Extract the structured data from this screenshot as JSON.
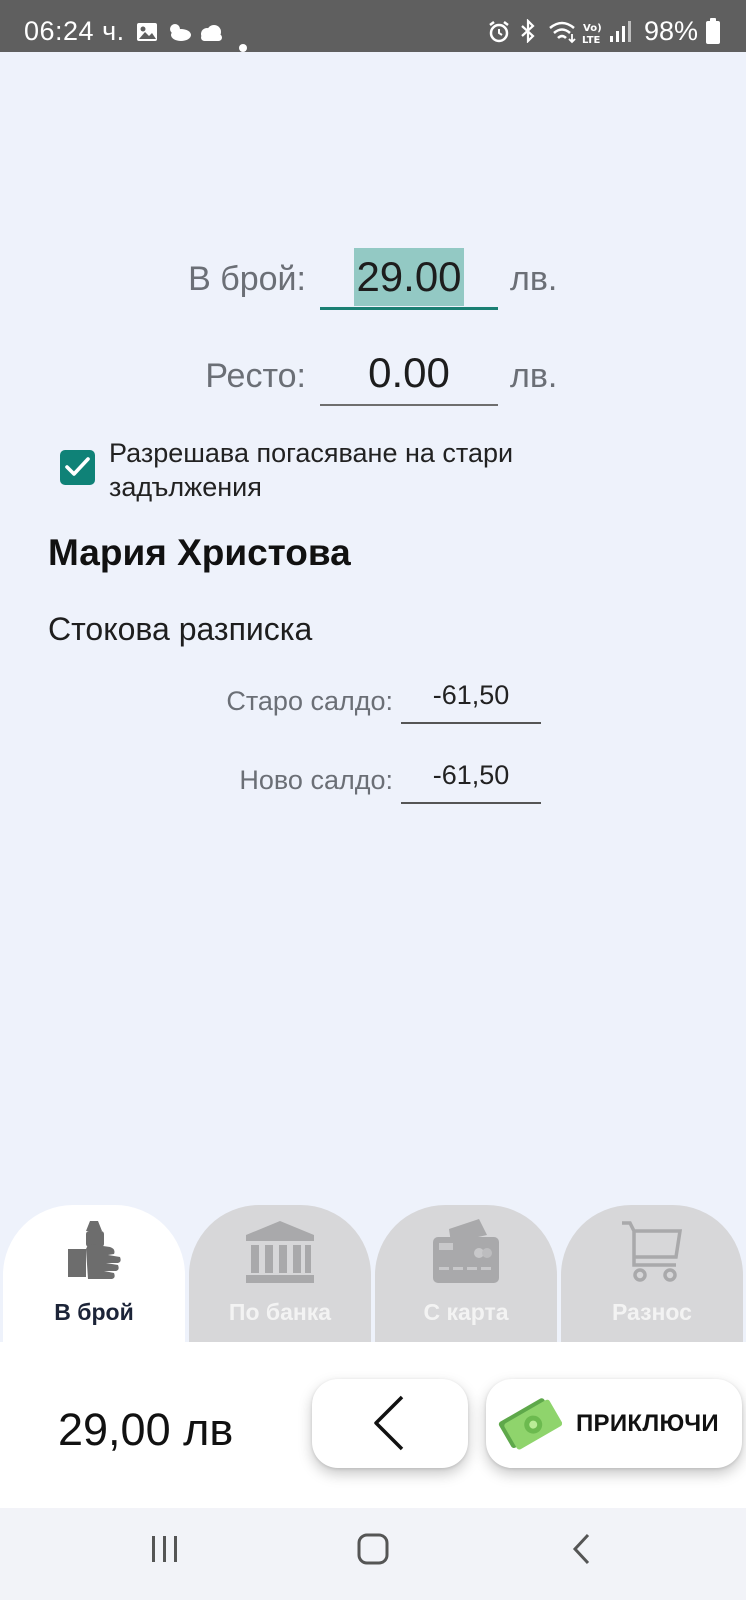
{
  "status_bar": {
    "time": "06:24 ч.",
    "battery": "98%",
    "icons": [
      "gallery-icon",
      "partly-sunny-icon",
      "cloud-icon",
      "dot-icon",
      "alarm-icon",
      "bluetooth-icon",
      "wifi-icon",
      "volte-icon",
      "signal-icon",
      "battery-icon"
    ]
  },
  "payment": {
    "cash_label": "В брой:",
    "cash_value": "29.00",
    "change_label": "Ресто:",
    "change_value": "0.00",
    "currency": "лв."
  },
  "checkbox": {
    "checked": true,
    "label": "Разрешава погасяване на стари задължения"
  },
  "customer_name": "Мария Христова",
  "document_type": "Стокова разписка",
  "balance": {
    "old_label": "Старо салдо:",
    "old_value": "-61,50",
    "new_label": "Ново салдо:",
    "new_value": "-61,50"
  },
  "tabs": [
    {
      "label": "В брой",
      "icon": "cash-hand-icon",
      "active": true
    },
    {
      "label": "По банка",
      "icon": "bank-icon",
      "active": false
    },
    {
      "label": "С карта",
      "icon": "credit-card-icon",
      "active": false
    },
    {
      "label": "Разнос",
      "icon": "cart-icon",
      "active": false
    }
  ],
  "footer": {
    "total": "29,00 лв",
    "back_icon": "chevron-left-icon",
    "finish_label": "ПРИКЛЮЧИ",
    "finish_icon": "money-icon"
  },
  "colors": {
    "accent": "#0f8277",
    "selection": "#93c9c4",
    "background": "#eef2fb",
    "tab_inactive": "#d7d7d9"
  }
}
